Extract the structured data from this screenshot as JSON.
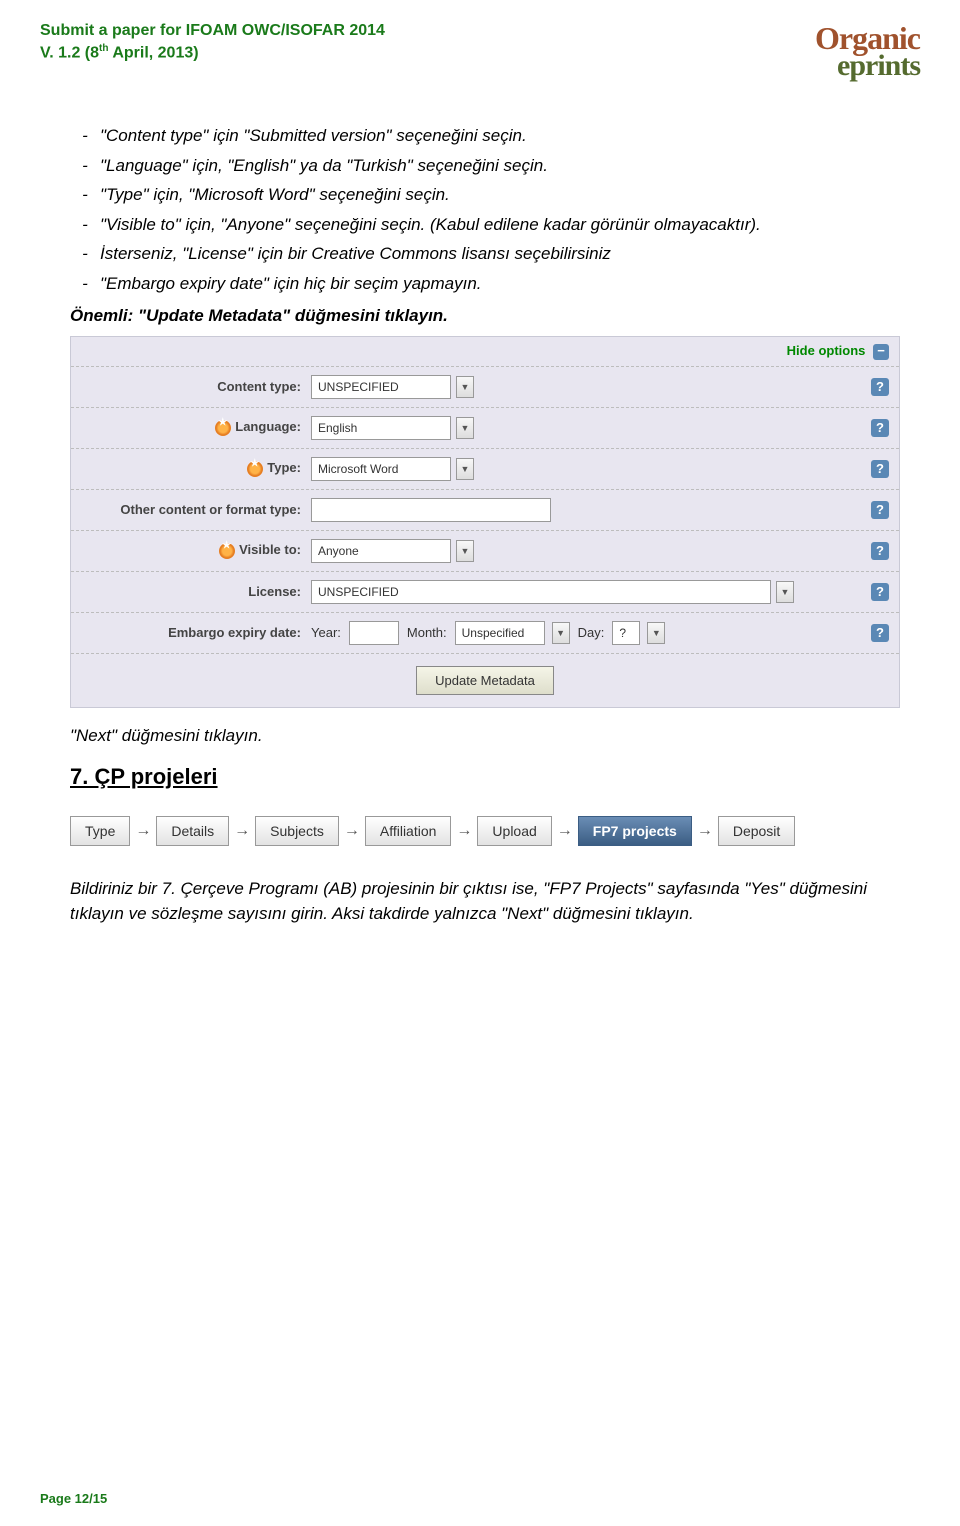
{
  "header": {
    "title_line1": "Submit a paper for IFOAM OWC/ISOFAR 2014",
    "title_line2_prefix": "V. 1.2 (8",
    "title_line2_sup": "th",
    "title_line2_suffix": " April, 2013)",
    "logo_line1": "Organic",
    "logo_line2": "eprints"
  },
  "bullets": [
    "\"Content type\" için \"Submitted version\" seçeneğini seçin.",
    "\"Language\" için, \"English\" ya da \"Turkish\" seçeneğini seçin.",
    "\"Type\" için, \"Microsoft Word\" seçeneğini seçin.",
    "\"Visible to\" için, \"Anyone\" seçeneğini seçin. (Kabul edilene kadar görünür olmayacaktır).",
    "İsterseniz, \"License\" için bir Creative Commons lisansı seçebilirsiniz",
    "\"Embargo expiry date\" için hiç bir seçim yapmayın."
  ],
  "important": "Önemli: \"Update Metadata\" düğmesini tıklayın.",
  "form": {
    "hide_options": "Hide options",
    "rows": {
      "content_type": {
        "label": "Content type:",
        "value": "UNSPECIFIED"
      },
      "language": {
        "label": "Language:",
        "value": "English"
      },
      "type": {
        "label": "Type:",
        "value": "Microsoft Word"
      },
      "other": {
        "label": "Other content or format type:",
        "value": ""
      },
      "visible_to": {
        "label": "Visible to:",
        "value": "Anyone"
      },
      "license": {
        "label": "License:",
        "value": "UNSPECIFIED"
      }
    },
    "embargo": {
      "label": "Embargo expiry date:",
      "year_label": "Year:",
      "year_value": "",
      "month_label": "Month:",
      "month_value": "Unspecified",
      "day_label": "Day:",
      "day_value": "?"
    },
    "update_button": "Update Metadata"
  },
  "next_line": "\"Next\" düğmesini tıklayın.",
  "section7_title": "7. ÇP projeleri",
  "breadcrumb": {
    "items": [
      "Type",
      "Details",
      "Subjects",
      "Affiliation",
      "Upload",
      "FP7 projects",
      "Deposit"
    ],
    "active_index": 5
  },
  "body_text": "Bildiriniz bir 7. Çerçeve Programı (AB) projesinin bir çıktısı ise, \"FP7 Projects\" sayfasında \"Yes\" düğmesini tıklayın ve sözleşme sayısını girin. Aksi takdirde yalnızca \"Next\" düğmesini tıklayın.",
  "footer": "Page 12/15"
}
